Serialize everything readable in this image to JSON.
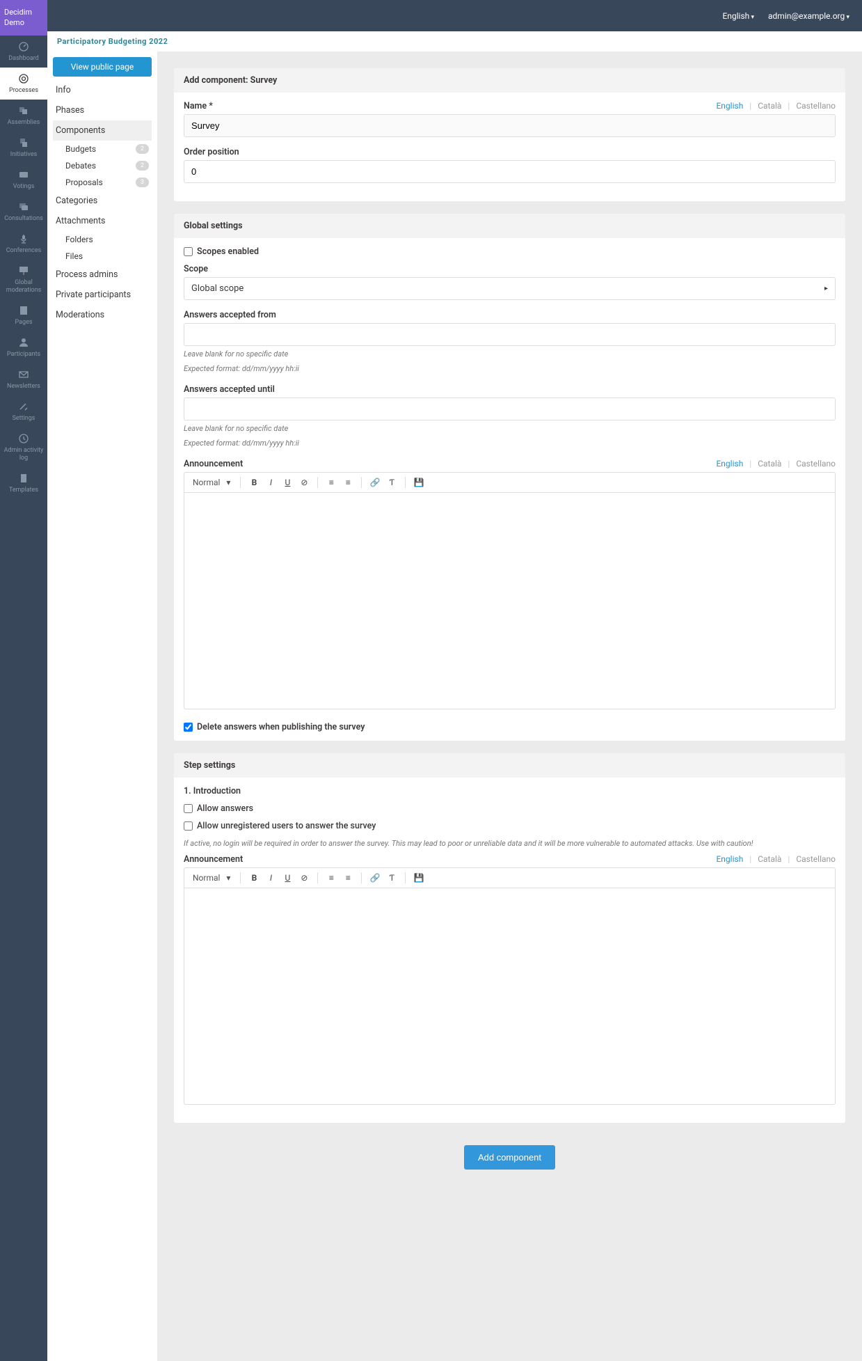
{
  "logo": "Decidim Demo",
  "topbar": {
    "language": "English",
    "user": "admin@example.org"
  },
  "breadcrumb": "Participatory Budgeting 2022",
  "rail": [
    {
      "id": "dashboard",
      "label": "Dashboard"
    },
    {
      "id": "processes",
      "label": "Processes",
      "active": true
    },
    {
      "id": "assemblies",
      "label": "Assemblies"
    },
    {
      "id": "initiatives",
      "label": "Initiatives"
    },
    {
      "id": "votings",
      "label": "Votings"
    },
    {
      "id": "consultations",
      "label": "Consultations"
    },
    {
      "id": "conferences",
      "label": "Conferences"
    },
    {
      "id": "global_moderations",
      "label": "Global moderations"
    },
    {
      "id": "pages",
      "label": "Pages"
    },
    {
      "id": "participants",
      "label": "Participants"
    },
    {
      "id": "newsletters",
      "label": "Newsletters"
    },
    {
      "id": "settings",
      "label": "Settings"
    },
    {
      "id": "admin_activity_log",
      "label": "Admin activity log"
    },
    {
      "id": "templates",
      "label": "Templates"
    }
  ],
  "side": {
    "view_public": "View public page",
    "items": [
      {
        "label": "Info"
      },
      {
        "label": "Phases"
      },
      {
        "label": "Components",
        "selected": true,
        "children": [
          {
            "label": "Budgets",
            "count": "2"
          },
          {
            "label": "Debates",
            "count": "2"
          },
          {
            "label": "Proposals",
            "count": "3"
          }
        ]
      },
      {
        "label": "Categories"
      },
      {
        "label": "Attachments",
        "children": [
          {
            "label": "Folders"
          },
          {
            "label": "Files"
          }
        ]
      },
      {
        "label": "Process admins"
      },
      {
        "label": "Private participants"
      },
      {
        "label": "Moderations"
      }
    ]
  },
  "page_title": "Add component: Survey",
  "langs": {
    "en": "English",
    "ca": "Català",
    "es": "Castellano"
  },
  "name": {
    "label": "Name *",
    "value": "Survey"
  },
  "order": {
    "label": "Order position",
    "value": "0"
  },
  "global": {
    "heading": "Global settings",
    "scopes_enabled": {
      "label": "Scopes enabled",
      "checked": false
    },
    "scope": {
      "label": "Scope",
      "value": "Global scope"
    },
    "from": {
      "label": "Answers accepted from",
      "value": "",
      "help1": "Leave blank for no specific date",
      "help2": "Expected format: dd/mm/yyyy hh:ii"
    },
    "until": {
      "label": "Answers accepted until",
      "value": "",
      "help1": "Leave blank for no specific date",
      "help2": "Expected format: dd/mm/yyyy hh:ii"
    },
    "announcement": {
      "label": "Announcement"
    },
    "delete_answers": {
      "label": "Delete answers when publishing the survey",
      "checked": true
    }
  },
  "step": {
    "heading": "Step settings",
    "phase": "1. Introduction",
    "allow_answers": {
      "label": "Allow answers",
      "checked": false
    },
    "allow_unregistered": {
      "label": "Allow unregistered users to answer the survey",
      "checked": false
    },
    "unregistered_help": "If active, no login will be required in order to answer the survey. This may lead to poor or unreliable data and it will be more vulnerable to automated attacks. Use with caution!",
    "announcement": {
      "label": "Announcement"
    }
  },
  "editor": {
    "format": "Normal"
  },
  "submit": "Add component"
}
